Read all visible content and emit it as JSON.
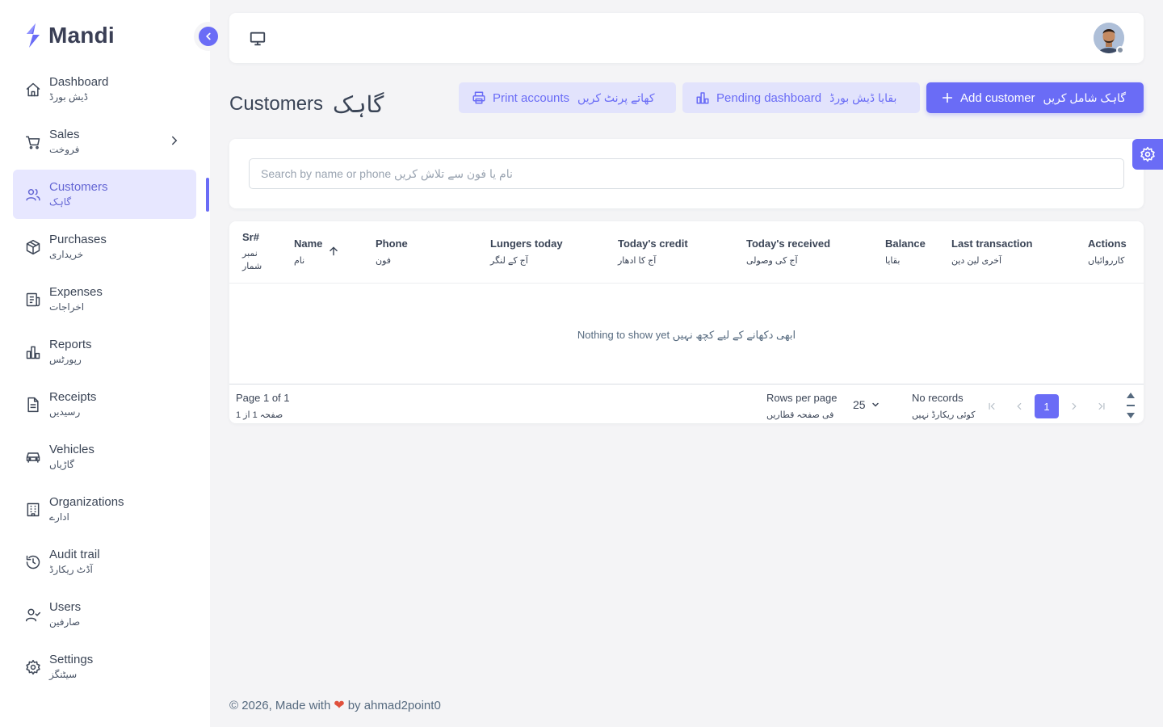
{
  "brand": {
    "name": "Mandi",
    "logo_icon": "bolt-s-logo",
    "accent": "#6a6cf6"
  },
  "sidebar": {
    "items": [
      {
        "en": "Dashboard",
        "ur": "ڈیش بورڈ",
        "icon": "home-icon"
      },
      {
        "en": "Sales",
        "ur": "فروخت",
        "icon": "cart-icon",
        "has_children": true
      },
      {
        "en": "Customers",
        "ur": "گاہک",
        "icon": "users-icon",
        "active": true
      },
      {
        "en": "Purchases",
        "ur": "خریداری",
        "icon": "box-icon"
      },
      {
        "en": "Expenses",
        "ur": "اخراجات",
        "icon": "receipt-icon"
      },
      {
        "en": "Reports",
        "ur": "رپورٹس",
        "icon": "bar-chart-icon"
      },
      {
        "en": "Receipts",
        "ur": "رسیدیں",
        "icon": "file-text-icon"
      },
      {
        "en": "Vehicles",
        "ur": "گاڑیاں",
        "icon": "car-icon"
      },
      {
        "en": "Organizations",
        "ur": "ادارے",
        "icon": "building-icon"
      },
      {
        "en": "Audit trail",
        "ur": "آڈٹ ریکارڈ",
        "icon": "history-icon"
      },
      {
        "en": "Users",
        "ur": "صارفین",
        "icon": "user-check-icon"
      },
      {
        "en": "Settings",
        "ur": "سیٹنگز",
        "icon": "gear-icon"
      }
    ]
  },
  "page": {
    "title_en": "Customers",
    "title_ur": "گاہک"
  },
  "actions": {
    "print": {
      "en": "Print accounts",
      "ur": "کھاتے پرنٹ کریں",
      "icon": "printer-icon"
    },
    "pending": {
      "en": "Pending dashboard",
      "ur": "بقایا ڈیش بورڈ",
      "icon": "bar-chart-icon"
    },
    "add": {
      "en": "Add customer",
      "ur": "گاہک شامل کریں",
      "icon": "plus-icon"
    }
  },
  "search": {
    "placeholder": "Search by name or phone  نام یا فون سے تلاش کریں"
  },
  "table": {
    "columns": [
      {
        "en": "Sr#",
        "ur": "نمبر شمار"
      },
      {
        "en": "Name",
        "ur": "نام",
        "sorted": "asc"
      },
      {
        "en": "Phone",
        "ur": "فون"
      },
      {
        "en": "Lungers today",
        "ur": "آج کے لنگر"
      },
      {
        "en": "Today's credit",
        "ur": "آج کا ادھار"
      },
      {
        "en": "Today's received",
        "ur": "آج کی وصولی"
      },
      {
        "en": "Balance",
        "ur": "بقایا"
      },
      {
        "en": "Last transaction",
        "ur": "آخری لین دین"
      },
      {
        "en": "Actions",
        "ur": "کارروائیاں"
      }
    ],
    "empty_text": "Nothing to show yet  ابھی دکھانے کے لیے کچھ نہیں"
  },
  "pagination": {
    "page_en": "Page 1 of 1",
    "page_ur": "صفحہ 1 از 1",
    "rows_per_page_en": "Rows per page",
    "rows_per_page_ur": "فی صفحہ قطاریں",
    "rows_per_page_value": "25",
    "records_en": "No records",
    "records_ur": "کوئی ریکارڈ نہیں",
    "current_page": "1"
  },
  "footer": {
    "prefix": "© 2026, Made with",
    "suffix": "by ahmad2point0"
  }
}
